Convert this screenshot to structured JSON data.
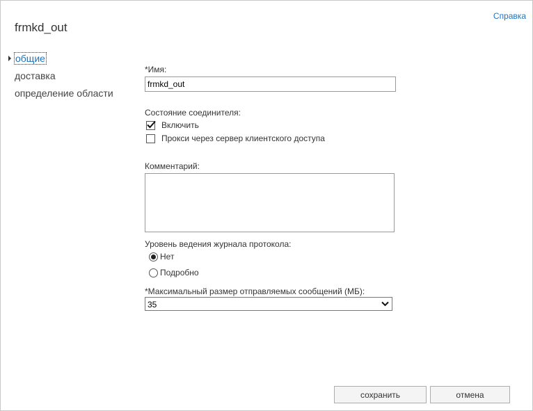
{
  "window": {
    "title": "frmkd_out",
    "help_label": "Справка"
  },
  "nav": {
    "items": [
      {
        "label": "общие",
        "active": true
      },
      {
        "label": "доставка",
        "active": false
      },
      {
        "label": "определение области",
        "active": false
      }
    ]
  },
  "form": {
    "name": {
      "label": "*Имя:",
      "value": "frmkd_out"
    },
    "connector_state": {
      "label": "Состояние соединителя:",
      "enable": {
        "label": "Включить",
        "checked": true
      },
      "proxy": {
        "label": "Прокси через сервер клиентского доступа",
        "checked": false
      }
    },
    "comment": {
      "label": "Комментарий:",
      "value": ""
    },
    "protocol_logging": {
      "label": "Уровень ведения журнала протокола:",
      "options": [
        {
          "label": "Нет",
          "selected": true
        },
        {
          "label": "Подробно",
          "selected": false
        }
      ]
    },
    "max_size": {
      "label": "*Максимальный размер отправляемых сообщений (МБ):",
      "value": "35"
    }
  },
  "buttons": {
    "save_label": "сохранить",
    "cancel_label": "отмена"
  },
  "colors": {
    "link": "#1e73be",
    "border": "#c8c8c8",
    "button_bg": "#f4f4f4"
  }
}
